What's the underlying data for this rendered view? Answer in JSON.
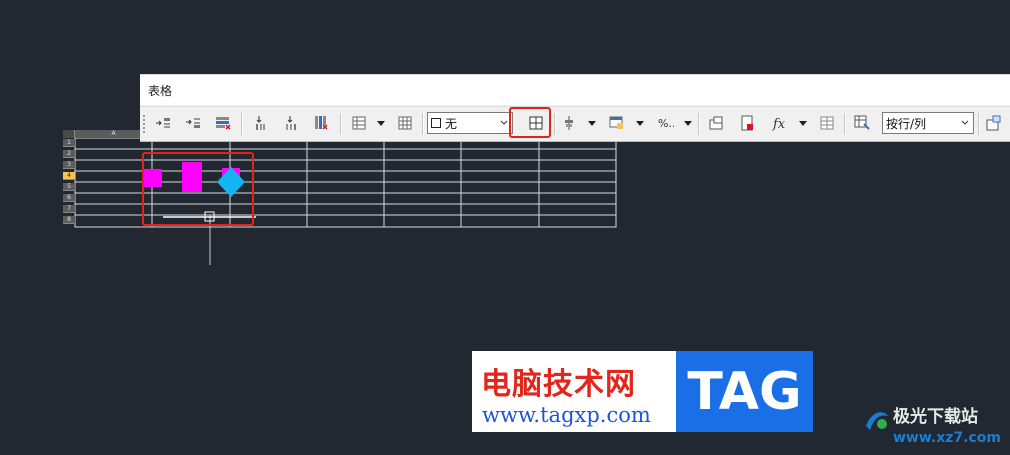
{
  "toolbar": {
    "title": "表格",
    "border_style_value": "无",
    "row_col_select_value": "按行/列"
  },
  "grid": {
    "column_header": "A",
    "row_numbers": [
      "1",
      "2",
      "3",
      "4",
      "5",
      "6",
      "7",
      "8"
    ],
    "active_row": "4"
  },
  "icons": {
    "insert-row-above": "insert-row-above-icon",
    "insert-row-below": "insert-row-below-icon",
    "delete-row": "delete-row-icon",
    "insert-col-left": "insert-column-left-icon",
    "insert-col-right": "insert-column-right-icon",
    "delete-col": "delete-column-icon",
    "merge-cells": "merge-cells-icon",
    "unmerge-cells": "unmerge-cells-icon",
    "cell-borders": "cell-borders-icon",
    "align": "align-icon",
    "cell-style": "cell-style-icon",
    "data-format": "data-format-icon",
    "insert-block": "insert-block-icon",
    "insert-field": "insert-field-icon",
    "formula": "formula-icon",
    "manage-cell-content": "manage-cell-content-icon",
    "link-cell": "link-cell-icon",
    "download": "download-icon"
  },
  "colors": {
    "canvas_bg": "#222831",
    "highlight_red": "#e2231a",
    "magenta_shape": "#ff00ff",
    "cyan_shape": "#11b5f0"
  },
  "watermark": {
    "title": "电脑技术网",
    "url": "www.tagxp.com",
    "tag": "TAG",
    "site2_name": "极光下载站",
    "site2_url": "www.xz7.com"
  }
}
